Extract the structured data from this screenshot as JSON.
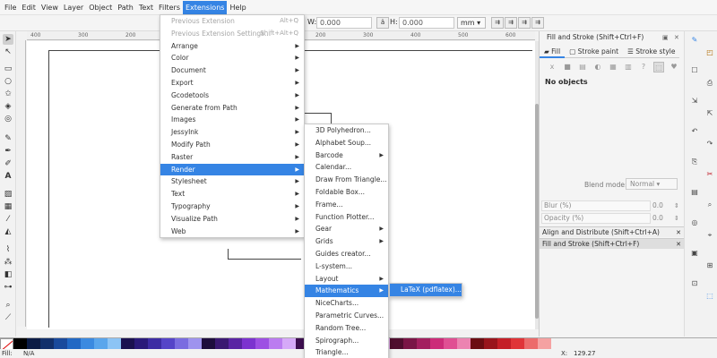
{
  "menubar": {
    "items": [
      "File",
      "Edit",
      "View",
      "Layer",
      "Object",
      "Path",
      "Text",
      "Filters",
      "Extensions",
      "Help"
    ],
    "active": "Extensions"
  },
  "toolbar": {
    "w_label": "W:",
    "w_value": "0.000",
    "h_label": "H:",
    "h_value": "0.000",
    "unit": "mm"
  },
  "ruler": {
    "ticks": [
      "400",
      "300",
      "200",
      "100",
      "0",
      "100",
      "200",
      "300",
      "400",
      "500",
      "600"
    ]
  },
  "extensions_menu": {
    "items": [
      {
        "label": "Previous Extension",
        "accel": "Alt+Q",
        "disabled": true
      },
      {
        "label": "Previous Extension Settings...",
        "accel": "Shift+Alt+Q",
        "disabled": true
      },
      {
        "label": "Arrange",
        "submenu": true
      },
      {
        "label": "Color",
        "submenu": true
      },
      {
        "label": "Document",
        "submenu": true
      },
      {
        "label": "Export",
        "submenu": true
      },
      {
        "label": "Gcodetools",
        "submenu": true
      },
      {
        "label": "Generate from Path",
        "submenu": true
      },
      {
        "label": "Images",
        "submenu": true
      },
      {
        "label": "JessyInk",
        "submenu": true
      },
      {
        "label": "Modify Path",
        "submenu": true
      },
      {
        "label": "Raster",
        "submenu": true
      },
      {
        "label": "Render",
        "submenu": true,
        "highlighted": true
      },
      {
        "label": "Stylesheet",
        "submenu": true
      },
      {
        "label": "Text",
        "submenu": true
      },
      {
        "label": "Typography",
        "submenu": true
      },
      {
        "label": "Visualize Path",
        "submenu": true
      },
      {
        "label": "Web",
        "submenu": true
      }
    ]
  },
  "render_menu": {
    "items": [
      {
        "label": "3D Polyhedron..."
      },
      {
        "label": "Alphabet Soup..."
      },
      {
        "label": "Barcode",
        "submenu": true
      },
      {
        "label": "Calendar..."
      },
      {
        "label": "Draw From Triangle..."
      },
      {
        "label": "Foldable Box..."
      },
      {
        "label": "Frame..."
      },
      {
        "label": "Function Plotter..."
      },
      {
        "label": "Gear",
        "submenu": true
      },
      {
        "label": "Grids",
        "submenu": true
      },
      {
        "label": "Guides creator..."
      },
      {
        "label": "L-system..."
      },
      {
        "label": "Layout",
        "submenu": true
      },
      {
        "label": "Mathematics",
        "submenu": true,
        "highlighted": true
      },
      {
        "label": "NiceCharts..."
      },
      {
        "label": "Parametric Curves..."
      },
      {
        "label": "Random Tree..."
      },
      {
        "label": "Spirograph..."
      },
      {
        "label": "Triangle..."
      }
    ]
  },
  "mathematics_menu": {
    "items": [
      {
        "label": "LaTeX (pdflatex)...",
        "highlighted": true
      }
    ]
  },
  "fill_stroke": {
    "title": "Fill and Stroke (Shift+Ctrl+F)",
    "tabs": [
      "Fill",
      "Stroke paint",
      "Stroke style"
    ],
    "paint_icons": [
      "x",
      "■",
      "▤",
      "◐",
      "▦",
      "▥",
      "?",
      "⬚",
      "♥"
    ],
    "no_objects": "No objects",
    "blend_label": "Blend mode:",
    "blend_value": "Normal",
    "blur_label": "Blur (%)",
    "blur_value": "0.0",
    "opacity_label": "Opacity (%)",
    "opacity_value": "0.0",
    "docked": [
      {
        "label": "Align and Distribute (Shift+Ctrl+A)"
      },
      {
        "label": "Fill and Stroke (Shift+Ctrl+F)",
        "active": true
      }
    ]
  },
  "status": {
    "fill_label": "Fill:",
    "fill_value": "N/A",
    "x_label": "X:",
    "x_value": "129.27"
  },
  "palette": {
    "colors": [
      "#000000",
      "#0b1b45",
      "#12306b",
      "#1a4a9c",
      "#2268c4",
      "#3b8ae0",
      "#5aa6ec",
      "#8cc4f5",
      "#1a1150",
      "#2a1a7a",
      "#3d2ca3",
      "#5544c8",
      "#7a6ce0",
      "#9e93ee",
      "#1d0d3d",
      "#3a1872",
      "#5a24a3",
      "#7c33cf",
      "#9d4fe3",
      "#bb7cf0",
      "#d6a9f8",
      "#3d0e4f",
      "#5c157a",
      "#7d1fa3",
      "#a02ccc",
      "#c24fe0",
      "#d883ec",
      "#ecb6f6",
      "#4f0d2e",
      "#7a1546",
      "#a31f5f",
      "#cc2c79",
      "#e04f93",
      "#ec83b1",
      "#6b0d12",
      "#99151c",
      "#c41f27",
      "#e03438",
      "#ec6b6b",
      "#f5a2a2"
    ]
  }
}
